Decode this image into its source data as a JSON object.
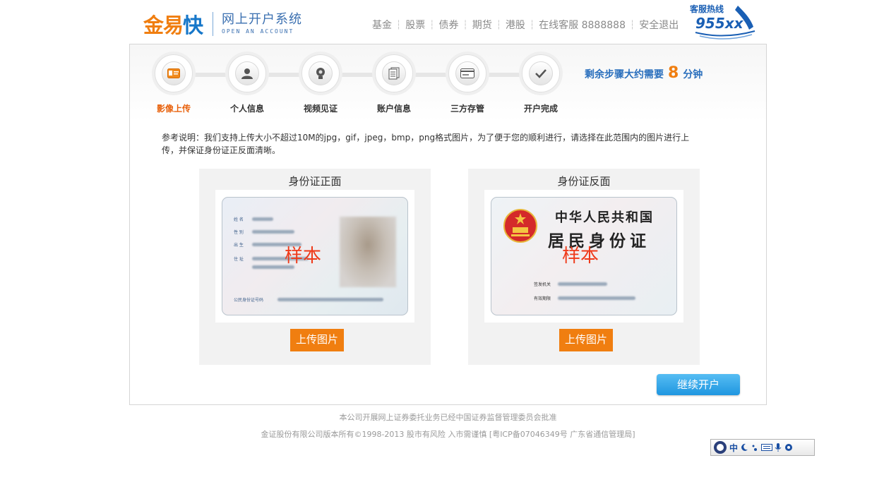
{
  "header": {
    "logo_part1": "金易",
    "logo_part2": "快",
    "system_name": "网上开户系统",
    "system_name_en": "OPEN AN ACCOUNT",
    "nav": [
      "基金",
      "股票",
      "债券",
      "期货",
      "港股",
      "在线客服 8888888",
      "安全退出"
    ],
    "hotline_label": "客服热线",
    "hotline_number": "955xx"
  },
  "steps": [
    {
      "label": "影像上传",
      "icon": "id-card-icon",
      "active": true
    },
    {
      "label": "个人信息",
      "icon": "person-icon",
      "active": false
    },
    {
      "label": "视频见证",
      "icon": "webcam-icon",
      "active": false
    },
    {
      "label": "账户信息",
      "icon": "documents-icon",
      "active": false
    },
    {
      "label": "三方存管",
      "icon": "card-icon",
      "active": false
    },
    {
      "label": "开户完成",
      "icon": "checkmark-icon",
      "active": false
    }
  ],
  "remaining": {
    "prefix": "剩余步骤大约需要",
    "minutes": "8",
    "suffix": "分钟"
  },
  "note": "参考说明：我们支持上传大小不超过10M的jpg，gif，jpeg，bmp，png格式图片，为了便于您的顺利进行，请选择在此范围内的图片进行上传，并保证身份证正反面清晰。",
  "front": {
    "title": "身份证正面",
    "watermark": "样本",
    "field_labels": [
      "姓 名",
      "性 别",
      "出 生",
      "住 址"
    ],
    "id_label": "公民身份证号码",
    "upload_label": "上传图片"
  },
  "back": {
    "title": "身份证反面",
    "country": "中华人民共和国",
    "card_name": "居民身份证",
    "watermark": "样本",
    "authority_label": "签发机关",
    "validity_label": "有效期限",
    "upload_label": "上传图片"
  },
  "continue_label": "继续开户",
  "footer": {
    "line1": "本公司开展网上证券委托业务已经中国证券监督管理委员会批准",
    "line2": "金证股份有限公司版本所有©1998-2013  股市有风险 入市需谨慎  [粤ICP备07046349号 广东省通信管理局]"
  },
  "ime_toolbar": {
    "lang": "中"
  },
  "colors": {
    "accent_orange": "#f07e10",
    "brand_blue": "#1a5fb4",
    "button_blue": "#2aa0e6"
  }
}
